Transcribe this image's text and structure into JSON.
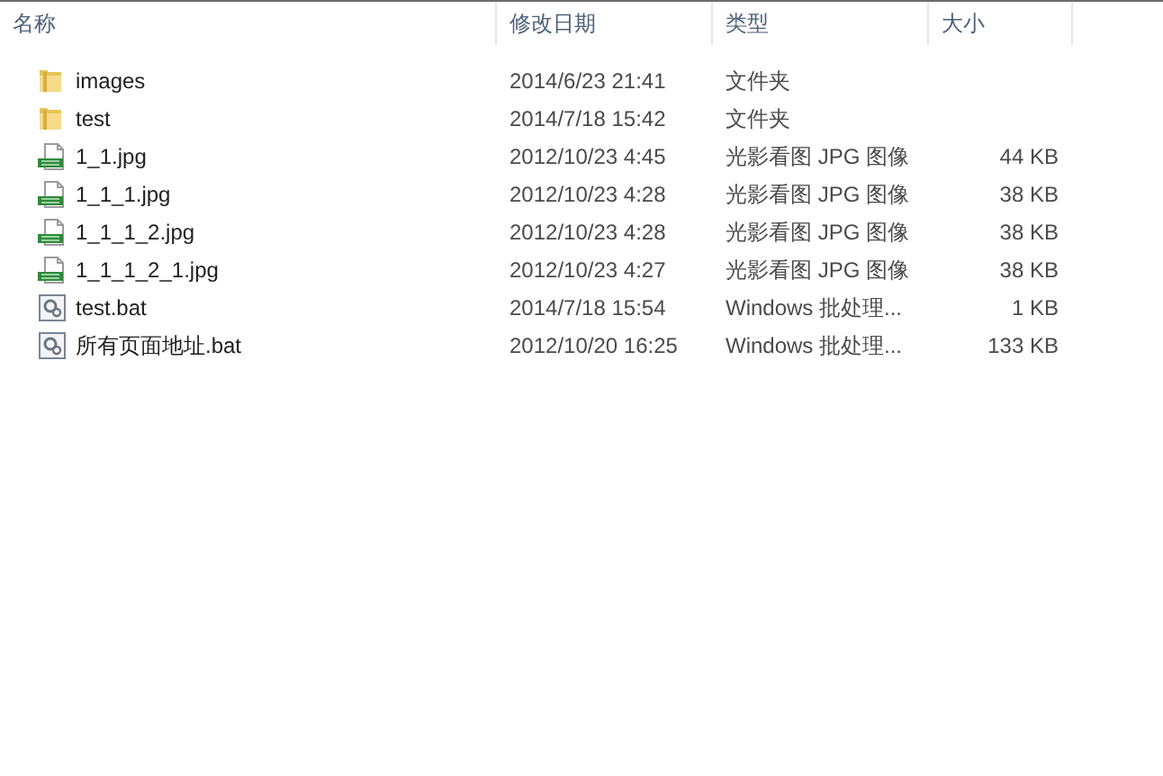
{
  "columns": [
    {
      "label": "名称"
    },
    {
      "label": "修改日期"
    },
    {
      "label": "类型"
    },
    {
      "label": "大小"
    }
  ],
  "rows": [
    {
      "kind": "folder",
      "name": "images",
      "modified": "2014/6/23 21:41",
      "type": "文件夹"
    },
    {
      "kind": "folder",
      "name": "test",
      "modified": "2014/7/18 15:42",
      "type": "文件夹"
    },
    {
      "kind": "jpeg",
      "name": "1_1.jpg",
      "modified": "2012/10/23 4:45",
      "type": "光影看图 JPG 图像",
      "size": "44 KB"
    },
    {
      "kind": "jpeg",
      "name": "1_1_1.jpg",
      "modified": "2012/10/23 4:28",
      "type": "光影看图 JPG 图像",
      "size": "38 KB"
    },
    {
      "kind": "jpeg",
      "name": "1_1_1_2.jpg",
      "modified": "2012/10/23 4:28",
      "type": "光影看图 JPG 图像",
      "size": "38 KB"
    },
    {
      "kind": "jpeg",
      "name": "1_1_1_2_1.jpg",
      "modified": "2012/10/23 4:27",
      "type": "光影看图 JPG 图像",
      "size": "38 KB"
    },
    {
      "kind": "bat",
      "name": "test.bat",
      "modified": "2014/7/18 15:54",
      "type": "Windows 批处理...",
      "size": "1 KB"
    },
    {
      "kind": "bat",
      "name": "所有页面地址.bat",
      "modified": "2012/10/20 16:25",
      "type": "Windows 批处理...",
      "size": "133 KB"
    }
  ]
}
